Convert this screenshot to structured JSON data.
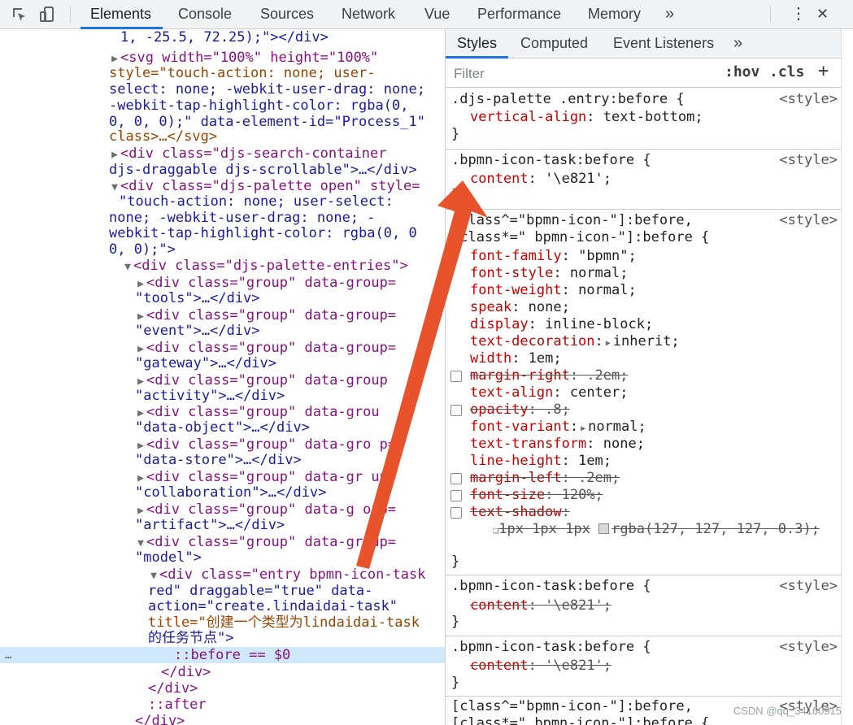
{
  "toolbar": {
    "tabs": [
      "Elements",
      "Console",
      "Sources",
      "Network",
      "Vue",
      "Performance",
      "Memory"
    ],
    "more": "»",
    "kebab": "⋮",
    "close": "✕"
  },
  "tree": {
    "lines": [
      "1, -25.5, 72.25);\"></div>",
      "<svg width=\"100%\" height=\"100%\"",
      "style=\"touch-action: none; user-",
      "select: none; -webkit-user-drag: none;",
      "-webkit-tap-highlight-color: rgba(0,",
      "0, 0, 0);\" data-element-id=\"Process_1\"",
      "class>…</svg>",
      "<div class=\"djs-search-container",
      "djs-draggable djs-scrollable\">…</div>",
      "<div class=\"djs-palette open\" style=",
      "\"touch-action: none; user-select:",
      "none; -webkit-user-drag: none; -",
      "webkit-tap-highlight-color: rgba(0, 0",
      "0, 0);\">",
      "<div class=\"djs-palette-entries\">",
      "<div class=\"group\" data-group=",
      "\"tools\">…</div>",
      "<div class=\"group\" data-group=",
      "\"event\">…</div>",
      "<div class=\"group\" data-group=",
      "\"gateway\">…</div>",
      "<div class=\"group\" data-group",
      "\"activity\">…</div>",
      "<div class=\"group\" data-grou",
      "\"data-object\">…</div>",
      "<div class=\"group\" data-gro p=",
      "\"data-store\">…</div>",
      "<div class=\"group\" data-gr up=",
      "\"collaboration\">…</div>",
      "<div class=\"group\" data-g oup=",
      "\"artifact\">…</div>",
      "<div class=\"group\" data-group=",
      "\"model\">",
      "<div class=\"entry bpmn-icon-task",
      "red\" draggable=\"true\" data-",
      "action=\"create.lindaidai-task\"",
      "title=\"创建一个类型为lindaidai-task",
      "的任务节点\">",
      "::before == $0",
      "</div>",
      "</div>",
      "::after",
      "</div>"
    ],
    "gutter_dots": "…"
  },
  "styles": {
    "tabs": [
      "Styles",
      "Computed",
      "Event Listeners"
    ],
    "more": "»",
    "filter_placeholder": "Filter",
    "hov": ":hov",
    "cls": ".cls",
    "plus": "+",
    "origin": "<style>",
    "rules": [
      {
        "selector": ".djs-palette .entry:before {",
        "props": [
          {
            "n": "vertical-align",
            "v": "text-bottom;"
          }
        ]
      },
      {
        "selector": ".bpmn-icon-task:before {",
        "props": [
          {
            "n": "content",
            "v": "'\\e821';"
          }
        ]
      },
      {
        "selector1": "[class^=\"bpmn-icon-\"]:before,",
        "selector2": "[class*=\" bpmn-icon-\"]:before {",
        "props": [
          {
            "n": "font-family",
            "v": "\"bpmn\";"
          },
          {
            "n": "font-style",
            "v": "normal;"
          },
          {
            "n": "font-weight",
            "v": "normal;"
          },
          {
            "n": "speak",
            "v": "none;"
          },
          {
            "n": "display",
            "v": "inline-block;"
          },
          {
            "n": "text-decoration",
            "v": "inherit;"
          },
          {
            "n": "width",
            "v": "1em;"
          },
          {
            "n": "margin-right",
            "v": ".2em;"
          },
          {
            "n": "text-align",
            "v": "center;"
          },
          {
            "n": "opacity",
            "v": ".8;"
          },
          {
            "n": "font-variant",
            "v": "normal;"
          },
          {
            "n": "text-transform",
            "v": "none;"
          },
          {
            "n": "line-height",
            "v": "1em;"
          },
          {
            "n": "margin-left",
            "v": ".2em;"
          },
          {
            "n": "font-size",
            "v": "120%;"
          },
          {
            "n": "text-shadow",
            "v": ""
          }
        ],
        "shadow_value": "1px 1px 1px",
        "shadow_color": "rgba(127, 127, 127, 0.3);"
      },
      {
        "selector": ".bpmn-icon-task:before {",
        "props": [
          {
            "n": "content",
            "v": "'\\e821';"
          }
        ]
      },
      {
        "selector": ".bpmn-icon-task:before {",
        "props": [
          {
            "n": "content",
            "v": "'\\e821';"
          }
        ]
      },
      {
        "selector1": "[class^=\"bpmn-icon-\"]:before,",
        "selector2": "[class*=\" bpmn-icon-\"]:before {"
      }
    ],
    "close_brace": "}"
  },
  "watermark": "CSDN @qq_34160915",
  "colors": {
    "arrow": "#e8532b",
    "accent": "#1a73e8",
    "selected_row": "#cfe8fc"
  }
}
